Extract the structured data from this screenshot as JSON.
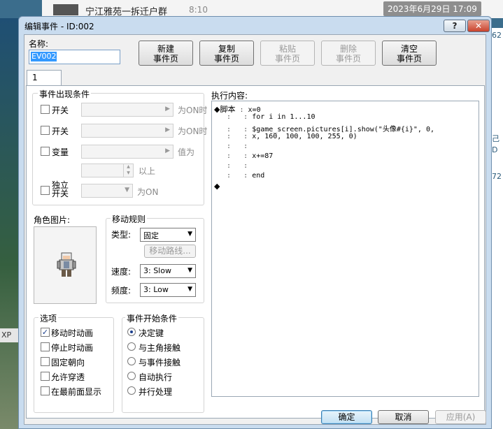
{
  "background": {
    "chat_title": "宁江雅苑一拆迁户群",
    "chat_time": "8:10",
    "date_badge": "2023年6月29日 17:09",
    "right_fragments": [
      "62",
      "己",
      "D",
      "72"
    ],
    "xp_label": "XP"
  },
  "window": {
    "title": "编辑事件 - ID:002",
    "help_label": "?",
    "close_label": "✕"
  },
  "name": {
    "label": "名称:",
    "value": "EV002"
  },
  "page_buttons": [
    {
      "line1": "新建",
      "line2": "事件页",
      "enabled": true
    },
    {
      "line1": "复制",
      "line2": "事件页",
      "enabled": true
    },
    {
      "line1": "粘贴",
      "line2": "事件页",
      "enabled": false
    },
    {
      "line1": "删除",
      "line2": "事件页",
      "enabled": false
    },
    {
      "line1": "清空",
      "line2": "事件页",
      "enabled": true
    }
  ],
  "tab_label": "1",
  "conditions": {
    "title": "事件出现条件",
    "switch1": {
      "label": "开关",
      "suffix": "为ON时"
    },
    "switch2": {
      "label": "开关",
      "suffix": "为ON时"
    },
    "variable": {
      "label": "变量",
      "suffix": "值为"
    },
    "above_label": "以上",
    "self_switch": {
      "label1": "独立",
      "label2": "开关",
      "suffix": "为ON"
    }
  },
  "graphic": {
    "label": "角色图片:"
  },
  "movement": {
    "title": "移动规则",
    "type_label": "类型:",
    "type_value": "固定",
    "route_button": "移动路线...",
    "speed_label": "速度:",
    "speed_value": "3: Slow",
    "freq_label": "频度:",
    "freq_value": "3: Low"
  },
  "options": {
    "title": "选项",
    "items": [
      {
        "label": "移动时动画",
        "checked": true
      },
      {
        "label": "停止时动画",
        "checked": false
      },
      {
        "label": "固定朝向",
        "checked": false
      },
      {
        "label": "允许穿透",
        "checked": false
      },
      {
        "label": "在最前面显示",
        "checked": false
      }
    ]
  },
  "trigger": {
    "title": "事件开始条件",
    "items": [
      {
        "label": "决定键",
        "selected": true
      },
      {
        "label": "与主角接触",
        "selected": false
      },
      {
        "label": "与事件接触",
        "selected": false
      },
      {
        "label": "自动执行",
        "selected": false
      },
      {
        "label": "并行处理",
        "selected": false
      }
    ]
  },
  "contents": {
    "label": "执行内容:",
    "lines": [
      {
        "prefix": "◆脚本",
        "text": "x=0"
      },
      {
        "prefix": "",
        "text": "for i in 1...10"
      },
      {
        "prefix": "",
        "text": "$game_screen.pictures[i].show(\"头像#{i}\", 0,"
      },
      {
        "prefix": "",
        "text": "x, 160, 100, 100, 255, 0)"
      },
      {
        "prefix": "",
        "text": ""
      },
      {
        "prefix": "",
        "text": "x+=87"
      },
      {
        "prefix": "",
        "text": ""
      },
      {
        "prefix": "",
        "text": "end"
      },
      {
        "prefix": "◆",
        "text": ""
      }
    ]
  },
  "footer": {
    "ok": "确定",
    "cancel": "取消",
    "apply": "应用(A)"
  }
}
